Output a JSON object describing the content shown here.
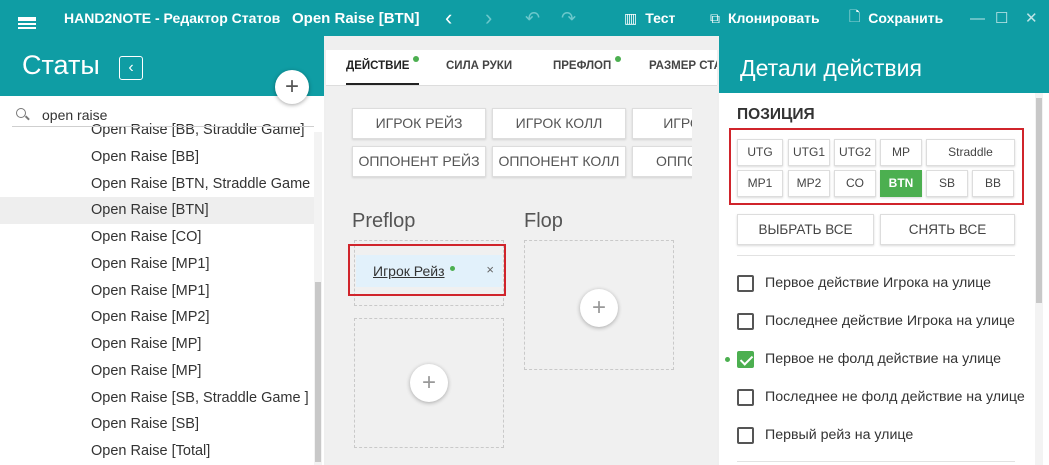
{
  "titlebar": {
    "app_title": "HAND2NOTE - Редактор Статов",
    "file_title": "Open Raise [BTN]",
    "back_glyph": "‹",
    "forward_glyph": "›",
    "undo_glyph": "↶",
    "redo_glyph": "↷",
    "test_label": "Тест",
    "clone_label": "Клонировать",
    "save_label": "Сохранить",
    "minimize_glyph": "—",
    "maximize_glyph": "☐",
    "close_glyph": "✕",
    "accent_color": "#0f9da4"
  },
  "left": {
    "title": "Статы",
    "back_glyph": "‹",
    "add_glyph": "+",
    "search_value": "open raise",
    "items": [
      "Open Raise [BB, Straddle Game]",
      "Open Raise [BB]",
      "Open Raise [BTN, Straddle Game ]",
      "Open Raise [BTN]",
      "Open Raise [CO]",
      "Open Raise [MP1]",
      "Open Raise [MP1]",
      "Open Raise [MP2]",
      "Open Raise [MP]",
      "Open Raise [MP]",
      "Open Raise [SB, Straddle Game ]",
      "Open Raise [SB]",
      "Open Raise [Total]"
    ],
    "selected_index": 3
  },
  "middle": {
    "tabs": [
      {
        "label": "ДЕЙСТВИЕ",
        "dot": true
      },
      {
        "label": "СИЛА РУКИ",
        "dot": false
      },
      {
        "label": "ПРЕФЛОП",
        "dot": true
      },
      {
        "label": "РАЗМЕР СТАВ",
        "dot": false
      }
    ],
    "actions": {
      "player_raise": "ИГРОК РЕЙЗ",
      "player_call": "ИГРОК КОЛЛ",
      "player_third": "ИГРО",
      "opp_raise": "ОППОНЕНТ РЕЙЗ",
      "opp_call": "ОППОНЕНТ КОЛЛ",
      "opp_third": "ОППОН"
    },
    "preflop_label": "Preflop",
    "flop_label": "Flop",
    "chip_label": "Игрок Рейз",
    "chip_close": "×",
    "add_glyph": "+"
  },
  "right": {
    "title": "Детали действия",
    "position_title": "ПОЗИЦИЯ",
    "positions_row1": [
      "UTG",
      "UTG1",
      "UTG2",
      "MP",
      "Straddle"
    ],
    "positions_row2": [
      "MP1",
      "MP2",
      "CO",
      "BTN",
      "SB",
      "BB"
    ],
    "active_position": "BTN",
    "select_all": "ВЫБРАТЬ ВСЕ",
    "clear_all": "СНЯТЬ ВСЕ",
    "checkboxes": [
      {
        "label": "Первое действие Игрока на улице",
        "checked": false
      },
      {
        "label": "Последнее действие Игрока на улице",
        "checked": false
      },
      {
        "label": "Первое не фолд действие на улице",
        "checked": true
      },
      {
        "label": "Последнее не фолд действие на улице",
        "checked": false
      },
      {
        "label": "Первый рейз на улице",
        "checked": false
      }
    ],
    "active_color": "#4caf50",
    "highlight_color": "#d0242b"
  }
}
